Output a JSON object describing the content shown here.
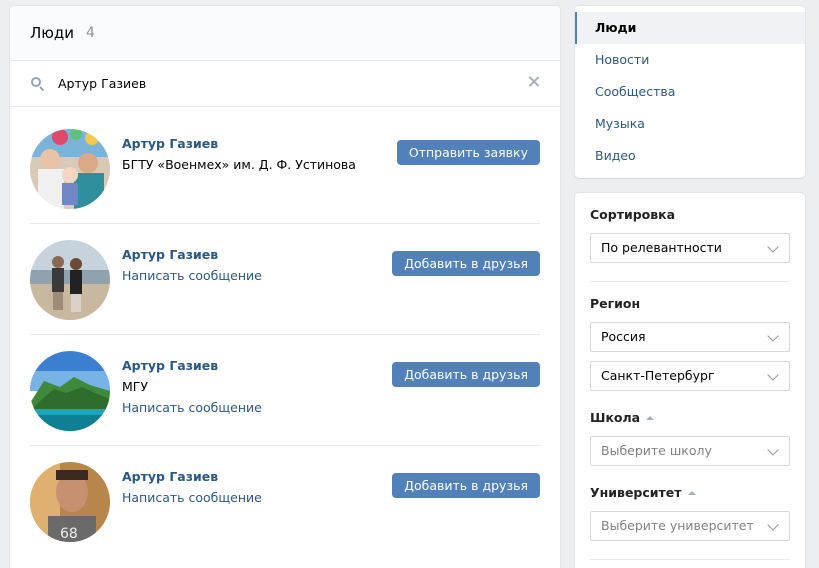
{
  "main": {
    "title": "Люди",
    "count": "4",
    "search": {
      "value": "Артур Газиев"
    }
  },
  "people": [
    {
      "name": "Артур Газиев",
      "line1": "БГТУ «Военмех» им. Д. Ф. Устинова",
      "line2": "",
      "action": "Отправить заявку"
    },
    {
      "name": "Артур Газиев",
      "line1": "Написать сообщение",
      "line2": "",
      "action": "Добавить в друзья"
    },
    {
      "name": "Артур Газиев",
      "line1": "МГУ",
      "line2": "Написать сообщение",
      "action": "Добавить в друзья"
    },
    {
      "name": "Артур Газиев",
      "line1": "Написать сообщение",
      "line2": "",
      "action": "Добавить в друзья"
    }
  ],
  "sidebar": {
    "items": [
      {
        "label": "Люди",
        "active": true
      },
      {
        "label": "Новости"
      },
      {
        "label": "Сообщества"
      },
      {
        "label": "Музыка"
      },
      {
        "label": "Видео"
      }
    ]
  },
  "filters": {
    "sort_label": "Сортировка",
    "sort_value": "По релевантности",
    "region_label": "Регион",
    "country_value": "Россия",
    "city_value": "Санкт-Петербург",
    "school_label": "Школа",
    "school_placeholder": "Выберите школу",
    "university_label": "Университет",
    "university_placeholder": "Выберите университет"
  },
  "colors": {
    "link": "#2a5885",
    "button": "#5181b8",
    "background": "#edeef0"
  }
}
